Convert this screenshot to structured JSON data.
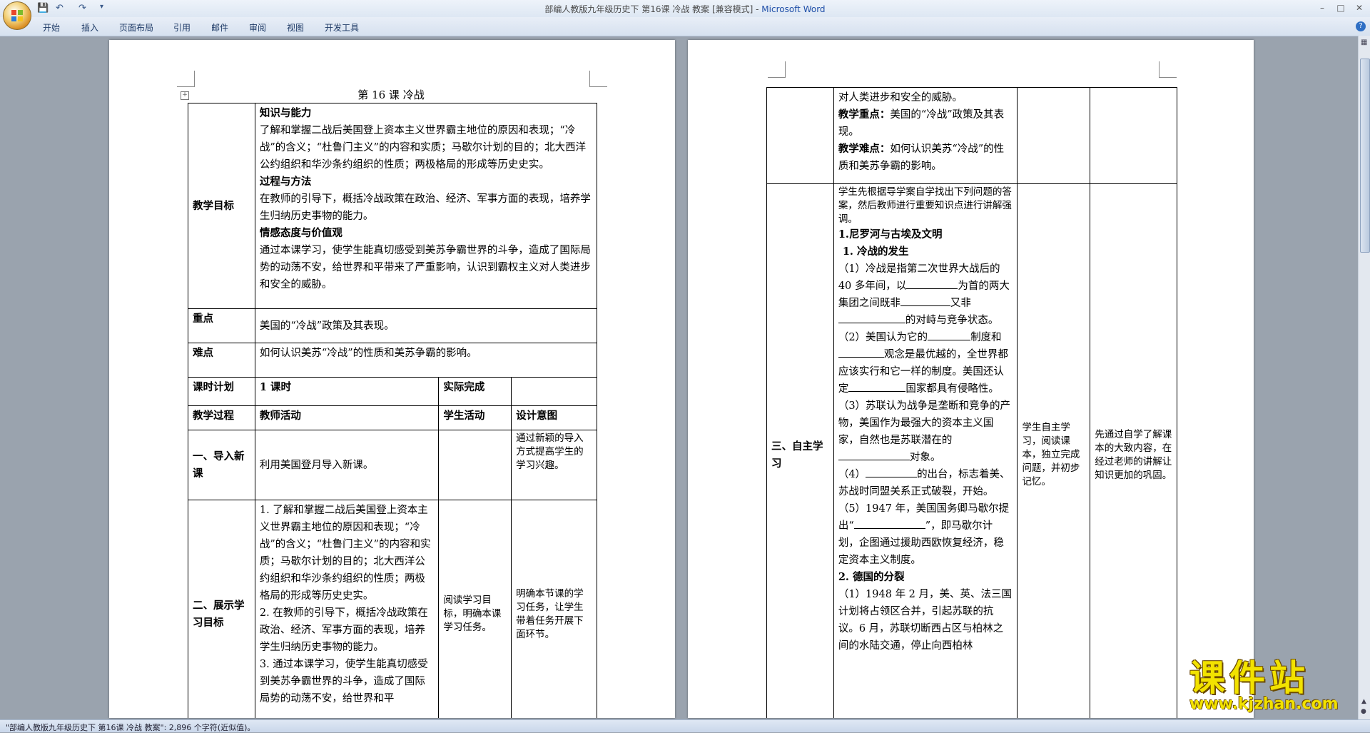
{
  "window": {
    "title_doc": "部编人教版九年级历史下 第16课 冷战 教案 [兼容模式] - ",
    "title_app": "Microsoft Word",
    "minimize": "–",
    "maximize": "□",
    "close": "✕"
  },
  "ribbon": {
    "tabs": [
      "开始",
      "插入",
      "页面布局",
      "引用",
      "邮件",
      "审阅",
      "视图",
      "开发工具"
    ],
    "help": "?"
  },
  "page1": {
    "heading": "第 16 课    冷战",
    "objectives": {
      "label": "教学目标",
      "h1": "知识与能力",
      "p1": "了解和掌握二战后美国登上资本主义世界霸主地位的原因和表现；“冷战”的含义；“杜鲁门主义”的内容和实质；马歇尔计划的目的；北大西洋公约组织和华沙条约组织的性质；两极格局的形成等历史史实。",
      "h2": "过程与方法",
      "p2": "在教师的引导下，概括冷战政策在政治、经济、军事方面的表现，培养学生归纳历史事物的能力。",
      "h3": "情感态度与价值观",
      "p3": "通过本课学习，使学生能真切感受到美苏争霸世界的斗争，造成了国际局势的动荡不安，给世界和平带来了严重影响，认识到霸权主义对人类进步和安全的威胁。"
    },
    "key": {
      "label": "重点",
      "text": "美国的“冷战”政策及其表现。"
    },
    "difficulty": {
      "label": "难点",
      "text": "如何认识美苏“冷战”的性质和美苏争霸的影响。"
    },
    "schedule": {
      "label": "课时计划",
      "value": "1 课时",
      "actual_label": "实际完成"
    },
    "process_header": {
      "c1": "教学过程",
      "c2": "教师活动",
      "c3": "学生活动",
      "c4": "设计意图"
    },
    "row_intro": {
      "stage": "一、导入新课",
      "teacher": "利用美国登月导入新课。",
      "intent": "通过新颖的导入方式提高学生的学习兴趣。"
    },
    "row_goals": {
      "stage": "二、展示学习目标",
      "teacher_1": "1. 了解和掌握二战后美国登上资本主义世界霸主地位的原因和表现；“冷战”的含义；“杜鲁门主义”的内容和实质；马歇尔计划的目的；北大西洋公约组织和华沙条约组织的性质；两极格局的形成等历史史实。",
      "teacher_2": "2. 在教师的引导下，概括冷战政策在政治、经济、军事方面的表现，培养学生归纳历史事物的能力。",
      "teacher_3": "3. 通过本课学习，使学生能真切感受到美苏争霸世界的斗争，造成了国际局势的动荡不安，给世界和平",
      "student": "阅读学习目标，明确本课学习任务。",
      "intent": "明确本节课的学习任务，让学生带着任务开展下面环节。"
    }
  },
  "page2": {
    "cont_line": "对人类进步和安全的威胁。",
    "key_label": "教学重点：",
    "key_text": "美国的“冷战”政策及其表现。",
    "diff_label": "教学难点：",
    "diff_text": "如何认识美苏“冷战”的性质和美苏争霸的影响。",
    "stage": "三、自主学习",
    "intro": "学生先根据导学案自学找出下列问题的答案，然后教师进行重要知识点进行讲解强调。",
    "s1": "1.尼罗河与古埃及文明",
    "s1a": "1. 冷战的发生",
    "q1": "（1）冷战是指第二次世界大战后的 40 多年间，以",
    "q1b": "为首的两大集团之间既非",
    "q1c": "又非",
    "q1d": "的对峙与竞争状态。",
    "q2": "（2）美国认为它的",
    "q2b": "制度和",
    "q2c": "观念是最优越的，全世界都应该实行和它一样的制度。美国还认定",
    "q2d": "国家都具有侵略性。",
    "q3": "（3）苏联认为战争是垄断和竞争的产物，美国作为最强大的资本主义国家，自然也是苏联潜在的",
    "q3b": "对象。",
    "q4": "（4）",
    "q4b": "的出台，标志着美、苏战时同盟关系正式破裂，开始。",
    "q5": "（5）1947 年，美国国务卿马歇尔提出“",
    "q5b": "”，即马歇尔计划，企图通过援助西欧恢复经济，稳定资本主义制度。",
    "s2": "2. 德国的分裂",
    "q6": "（1）1948 年 2 月，美、英、法三国计划将占领区合并，引起苏联的抗议。6 月，苏联切断西占区与柏林之间的水陆交通，停止向西柏林",
    "student": "学生自主学习，阅读课本，独立完成问题，并初步记忆。",
    "intent": "先通过自学了解课本的大致内容，在经过老师的讲解让知识更加的巩固。"
  },
  "status": {
    "text": "\"部编人教版九年级历史下 第16课 冷战 教案\": 2,896 个字符(近似值)。"
  },
  "watermark": {
    "main": "课件站",
    "url": "www.kjzhan.com"
  }
}
